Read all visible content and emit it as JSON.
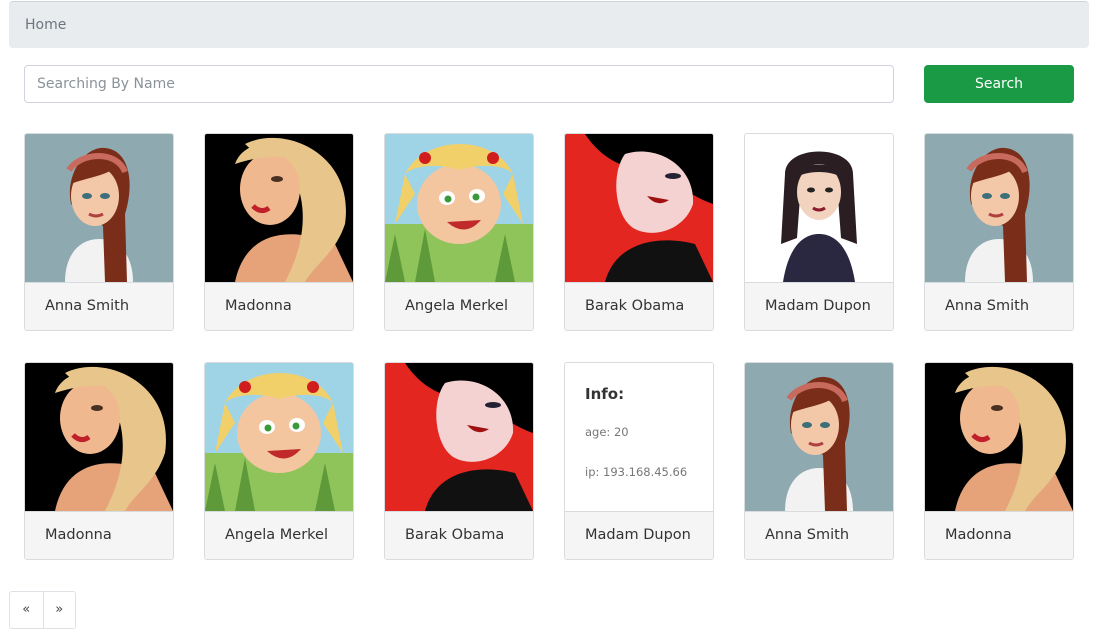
{
  "breadcrumb": {
    "label": "Home"
  },
  "search": {
    "placeholder": "Searching By Name",
    "button_label": "Search"
  },
  "colors": {
    "accent": "#1a9a44",
    "breadcrumb_bg": "#e9ecef",
    "card_footer_bg": "#f5f5f5"
  },
  "cards": [
    {
      "name": "Anna Smith",
      "avatar": "anna-smith-avatar"
    },
    {
      "name": "Madonna",
      "avatar": "madonna-avatar"
    },
    {
      "name": "Angela Merkel",
      "avatar": "angela-merkel-avatar"
    },
    {
      "name": "Barak Obama",
      "avatar": "barak-obama-avatar"
    },
    {
      "name": "Madam Dupon",
      "avatar": "madam-dupon-avatar"
    },
    {
      "name": "Anna Smith",
      "avatar": "anna-smith-avatar"
    },
    {
      "name": "Madonna",
      "avatar": "madonna-avatar"
    },
    {
      "name": "Angela Merkel",
      "avatar": "angela-merkel-avatar"
    },
    {
      "name": "Barak Obama",
      "avatar": "barak-obama-avatar"
    },
    {
      "name": "Madam Dupon",
      "info": {
        "title": "Info:",
        "age": "age: 20",
        "ip": "ip: 193.168.45.66"
      }
    },
    {
      "name": "Anna Smith",
      "avatar": "anna-smith-avatar"
    },
    {
      "name": "Madonna",
      "avatar": "madonna-avatar"
    }
  ],
  "pagination": {
    "prev": "«",
    "next": "»"
  }
}
